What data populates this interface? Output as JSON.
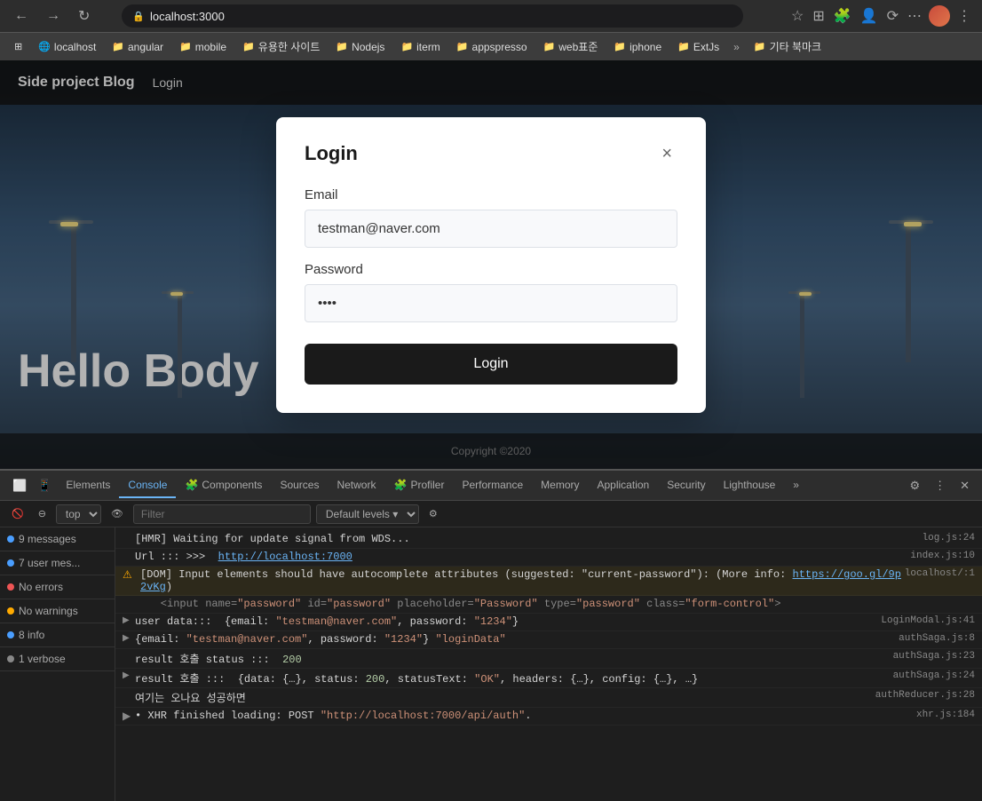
{
  "browser": {
    "url": "localhost:3000",
    "back_label": "←",
    "forward_label": "→",
    "refresh_label": "↻",
    "more_label": "⋯"
  },
  "bookmarks": [
    {
      "label": "앱",
      "icon": "⊞"
    },
    {
      "label": "localhost",
      "icon": "🌐"
    },
    {
      "label": "angular",
      "icon": "📁"
    },
    {
      "label": "mobile",
      "icon": "📁"
    },
    {
      "label": "유용한 사이트",
      "icon": "📁"
    },
    {
      "label": "Nodejs",
      "icon": "📁"
    },
    {
      "label": "iterm",
      "icon": "📁"
    },
    {
      "label": "appspresso",
      "icon": "📁"
    },
    {
      "label": "web표준",
      "icon": "📁"
    },
    {
      "label": "iphone",
      "icon": "📁"
    },
    {
      "label": "ExtJs",
      "icon": "📁"
    }
  ],
  "website": {
    "title": "Side project Blog",
    "nav_login": "Login",
    "hero_text": "Hello Body",
    "footer": "Copyright ©2020"
  },
  "modal": {
    "title": "Login",
    "close_label": "×",
    "email_label": "Email",
    "email_value": "testman@naver.com",
    "password_label": "Password",
    "password_value": "••••",
    "submit_label": "Login"
  },
  "devtools": {
    "tabs": [
      {
        "label": "Elements",
        "active": false
      },
      {
        "label": "Console",
        "active": true
      },
      {
        "label": "Components",
        "active": false,
        "icon": "🧩"
      },
      {
        "label": "Sources",
        "active": false
      },
      {
        "label": "Network",
        "active": false
      },
      {
        "label": "Profiler",
        "active": false,
        "icon": "🧩"
      },
      {
        "label": "Performance",
        "active": false
      },
      {
        "label": "Memory",
        "active": false
      },
      {
        "label": "Application",
        "active": false
      },
      {
        "label": "Security",
        "active": false
      },
      {
        "label": "Lighthouse",
        "active": false
      },
      {
        "label": "»",
        "active": false
      }
    ],
    "console_filter_placeholder": "Filter",
    "console_level": "Default levels ▾",
    "sidebar_messages": [
      {
        "icon": "blue",
        "label": "9 messages"
      },
      {
        "icon": "blue",
        "label": "7 user mes..."
      },
      {
        "icon": "red",
        "label": "No errors"
      },
      {
        "icon": "yellow",
        "label": "No warnings"
      },
      {
        "icon": "blue",
        "label": "8 info"
      },
      {
        "icon": "gray",
        "label": "1 verbose"
      }
    ],
    "console_lines": [
      {
        "type": "log",
        "expand": false,
        "prefix": "[HMR]",
        "msg": " Waiting for update signal from WDS...",
        "source": "log.js:24"
      },
      {
        "type": "log",
        "expand": false,
        "msg": "Url ::: >>>  http://localhost:7000",
        "source": "index.js:10"
      },
      {
        "type": "warn",
        "expand": false,
        "msg": "[DOM] Input elements should have autocomplete attributes (suggested: \"current-password\"): (More info: https://goo.gl/9p2vKg)",
        "source": "localhost/:1"
      },
      {
        "type": "log",
        "expand": false,
        "msg": "    <input name=\"password\" id=\"password\" placeholder=\"Password\" type=\"password\" class=\"form-control\">",
        "source": ""
      },
      {
        "type": "log",
        "expand": true,
        "msg": "user data:::  ▶ {email: \"testman@naver.com\", password: \"1234\"}",
        "source": "LoginModal.js:41"
      },
      {
        "type": "log",
        "expand": true,
        "msg": "▶ {email: \"testman@naver.com\", password: \"1234\"} \"loginData\"",
        "source": "authSaga.js:8"
      },
      {
        "type": "log",
        "expand": false,
        "msg": "result 호출 status :::  200",
        "source": "authSaga.js:23"
      },
      {
        "type": "log",
        "expand": true,
        "msg": "result 호출 :::  ▶ {data: {…}, status: 200, statusText: \"OK\", headers: {…}, config: {…}, …}",
        "source": "authSaga.js:24"
      },
      {
        "type": "log",
        "expand": false,
        "msg": "여기는 오나요 성공하면",
        "source": "authReducer.js:28"
      },
      {
        "type": "log",
        "expand": false,
        "msg": "• XHR finished loading: POST \"http://localhost:7000/api/auth\".",
        "source": "xhr.js:184"
      }
    ]
  }
}
